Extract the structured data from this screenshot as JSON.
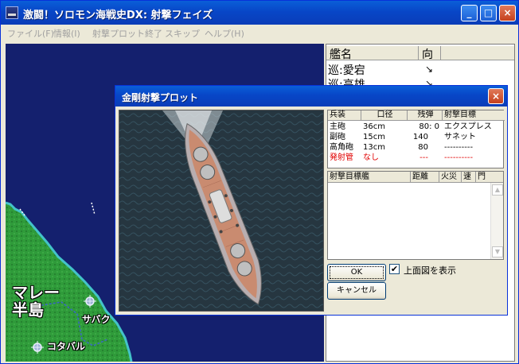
{
  "window": {
    "title": "激闘！ソロモン海戦史DX: 射撃フェイズ",
    "min_label": "_",
    "max_label": "□",
    "close_label": "×"
  },
  "menu": {
    "items": [
      "ファイル(F)",
      "情報(I)",
      "射撃プロット終了",
      "スキップ",
      "ヘルプ(H)"
    ]
  },
  "map": {
    "labels": {
      "region": "マレー\n半島",
      "region_line1": "マレー",
      "region_line2": "半島",
      "city1": "サバク",
      "city2": "コタバル"
    },
    "colors": {
      "sea": "#14206e",
      "land": "#2f9b3a",
      "coast": "#43c3c9"
    }
  },
  "ship_list": {
    "headers": {
      "name": "艦名",
      "dir": "向"
    },
    "rows": [
      {
        "name": "巡:愛宕",
        "dir": "↘"
      },
      {
        "name": "巡:高雄",
        "dir": "↘"
      }
    ]
  },
  "dialog": {
    "title": "金剛射撃プロット",
    "close_label": "×",
    "weapons": {
      "headers": [
        "兵装",
        "口径",
        "残弾",
        "射撃目標"
      ],
      "rows": [
        {
          "type": "主砲",
          "caliber": "36cm",
          "ammo": "80:  0",
          "target": "エクスプレス",
          "red": false
        },
        {
          "type": "副砲",
          "caliber": "15cm",
          "ammo": "140",
          "target": "サネット",
          "red": false
        },
        {
          "type": "高角砲",
          "caliber": "13cm",
          "ammo": "80",
          "target": "----------",
          "red": false
        },
        {
          "type": "発射管",
          "caliber": "なし",
          "ammo": "---",
          "target": "----------",
          "red": true
        }
      ]
    },
    "targets": {
      "headers": [
        "射撃目標艦",
        "距離",
        "火災",
        "速",
        "門"
      ]
    },
    "ok_label": "OK",
    "cancel_label": "キャンセル",
    "show_top_view_label": "上面図を表示",
    "show_top_view_checked": "✔"
  }
}
